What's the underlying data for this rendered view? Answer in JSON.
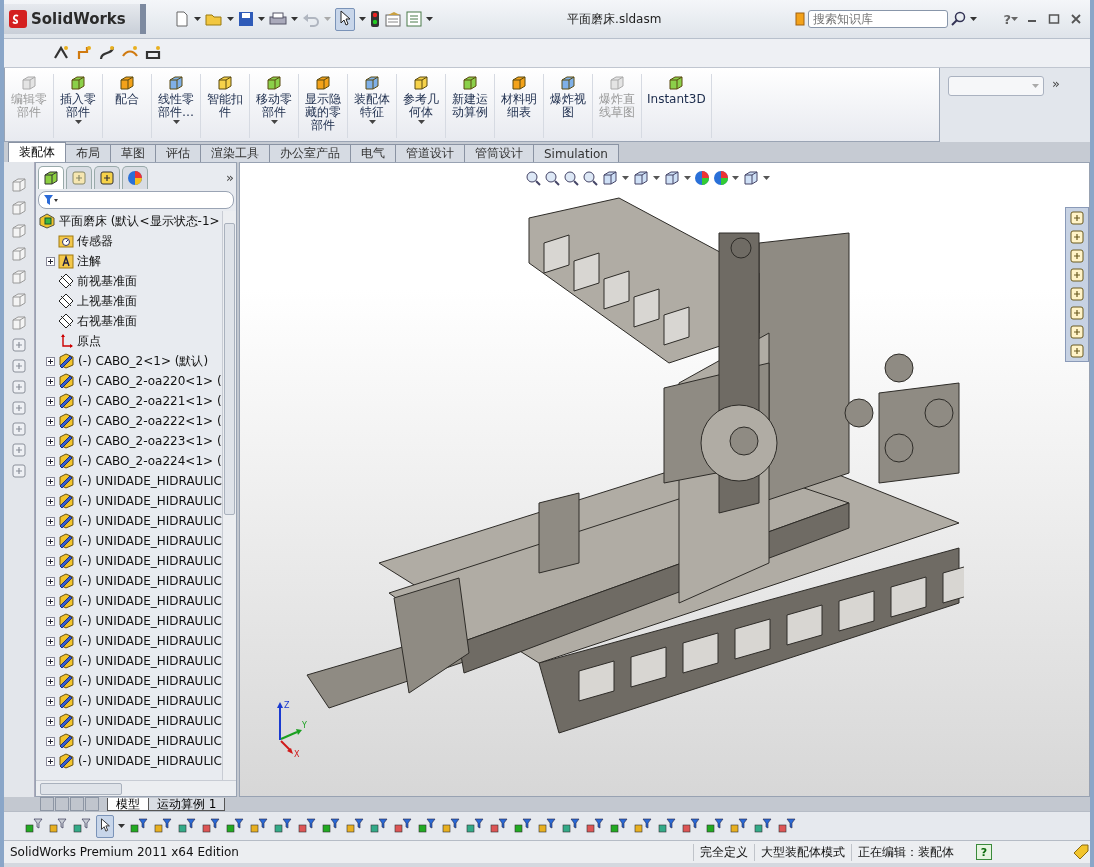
{
  "title_bar": {
    "brand": "SolidWorks",
    "title": "平面磨床.sldasm",
    "search": {
      "placeholder": "搜索知识库"
    },
    "help": "?"
  },
  "ribbon": {
    "buttons": [
      {
        "label": "编辑零部件",
        "disabled": true,
        "dropdown": false
      },
      {
        "label": "插入零部件",
        "disabled": false,
        "dropdown": true
      },
      {
        "label": "配合",
        "disabled": false,
        "dropdown": false
      },
      {
        "label": "线性零部件…",
        "disabled": false,
        "dropdown": true
      },
      {
        "label": "智能扣件",
        "disabled": false,
        "dropdown": false
      },
      {
        "label": "移动零部件",
        "disabled": false,
        "dropdown": true
      },
      {
        "label": "显示隐藏的零部件",
        "disabled": false,
        "dropdown": false
      },
      {
        "label": "装配体特征",
        "disabled": false,
        "dropdown": true
      },
      {
        "label": "参考几何体",
        "disabled": false,
        "dropdown": true
      },
      {
        "label": "新建运动算例",
        "disabled": false,
        "dropdown": false
      },
      {
        "label": "材料明细表",
        "disabled": false,
        "dropdown": false
      },
      {
        "label": "爆炸视图",
        "disabled": false,
        "dropdown": false
      },
      {
        "label": "爆炸直线草图",
        "disabled": true,
        "dropdown": false
      },
      {
        "label": "Instant3D",
        "disabled": false,
        "dropdown": false
      }
    ],
    "more": "»"
  },
  "tabs": [
    {
      "label": "装配体",
      "selected": true
    },
    {
      "label": "布局",
      "selected": false
    },
    {
      "label": "草图",
      "selected": false
    },
    {
      "label": "评估",
      "selected": false
    },
    {
      "label": "渲染工具",
      "selected": false
    },
    {
      "label": "办公室产品",
      "selected": false
    },
    {
      "label": "电气",
      "selected": false
    },
    {
      "label": "管道设计",
      "selected": false
    },
    {
      "label": "管筒设计",
      "selected": false
    },
    {
      "label": "Simulation",
      "selected": false
    }
  ],
  "tree_panel": {
    "tabs": [
      {
        "selected": true
      },
      {
        "selected": false
      },
      {
        "selected": false
      },
      {
        "selected": false
      }
    ],
    "more": "»",
    "root": {
      "label": "平面磨床  (默认<显示状态-1>",
      "children": [
        {
          "label": "传感器",
          "kind": "sensor",
          "expandable": false
        },
        {
          "label": "注解",
          "kind": "annotation",
          "expandable": true
        },
        {
          "label": "前视基准面",
          "kind": "plane",
          "expandable": false
        },
        {
          "label": "上视基准面",
          "kind": "plane",
          "expandable": false
        },
        {
          "label": "右视基准面",
          "kind": "plane",
          "expandable": false
        },
        {
          "label": "原点",
          "kind": "origin",
          "expandable": false
        },
        {
          "label": "(-) CABO_2<1> (默认)",
          "kind": "part",
          "expandable": true
        },
        {
          "label": "(-) CABO_2-oa220<1> (",
          "kind": "part",
          "expandable": true
        },
        {
          "label": "(-) CABO_2-oa221<1> (",
          "kind": "part",
          "expandable": true
        },
        {
          "label": "(-) CABO_2-oa222<1> (",
          "kind": "part",
          "expandable": true
        },
        {
          "label": "(-) CABO_2-oa223<1> (",
          "kind": "part",
          "expandable": true
        },
        {
          "label": "(-) CABO_2-oa224<1> (",
          "kind": "part",
          "expandable": true
        },
        {
          "label": "(-) UNIDADE_HIDRAULIC",
          "kind": "part",
          "expandable": true
        },
        {
          "label": "(-) UNIDADE_HIDRAULIC",
          "kind": "part",
          "expandable": true
        },
        {
          "label": "(-) UNIDADE_HIDRAULIC",
          "kind": "part",
          "expandable": true
        },
        {
          "label": "(-) UNIDADE_HIDRAULIC",
          "kind": "part",
          "expandable": true
        },
        {
          "label": "(-) UNIDADE_HIDRAULIC",
          "kind": "part",
          "expandable": true
        },
        {
          "label": "(-) UNIDADE_HIDRAULIC",
          "kind": "part",
          "expandable": true
        },
        {
          "label": "(-) UNIDADE_HIDRAULIC",
          "kind": "part",
          "expandable": true
        },
        {
          "label": "(-) UNIDADE_HIDRAULIC",
          "kind": "part",
          "expandable": true
        },
        {
          "label": "(-) UNIDADE_HIDRAULIC",
          "kind": "part",
          "expandable": true
        },
        {
          "label": "(-) UNIDADE_HIDRAULIC",
          "kind": "part",
          "expandable": true
        },
        {
          "label": "(-) UNIDADE_HIDRAULIC",
          "kind": "part",
          "expandable": true
        },
        {
          "label": "(-) UNIDADE_HIDRAULIC",
          "kind": "part",
          "expandable": true
        },
        {
          "label": "(-) UNIDADE_HIDRAULIC",
          "kind": "part",
          "expandable": true
        },
        {
          "label": "(-) UNIDADE_HIDRAULIC",
          "kind": "part",
          "expandable": true
        },
        {
          "label": "(-) UNIDADE_HIDRAULIC",
          "kind": "part",
          "expandable": true
        }
      ]
    }
  },
  "bottom_tabs": [
    {
      "label": "模型",
      "selected": true
    },
    {
      "label": "运动算例 1",
      "selected": false
    }
  ],
  "triad": {
    "x": "X",
    "y": "Y",
    "z": "Z"
  },
  "status_bar": {
    "edition": "SolidWorks Premium 2011 x64 Edition",
    "items": [
      "完全定义",
      "大型装配体模式",
      "正在编辑：装配体"
    ],
    "help": "?"
  }
}
